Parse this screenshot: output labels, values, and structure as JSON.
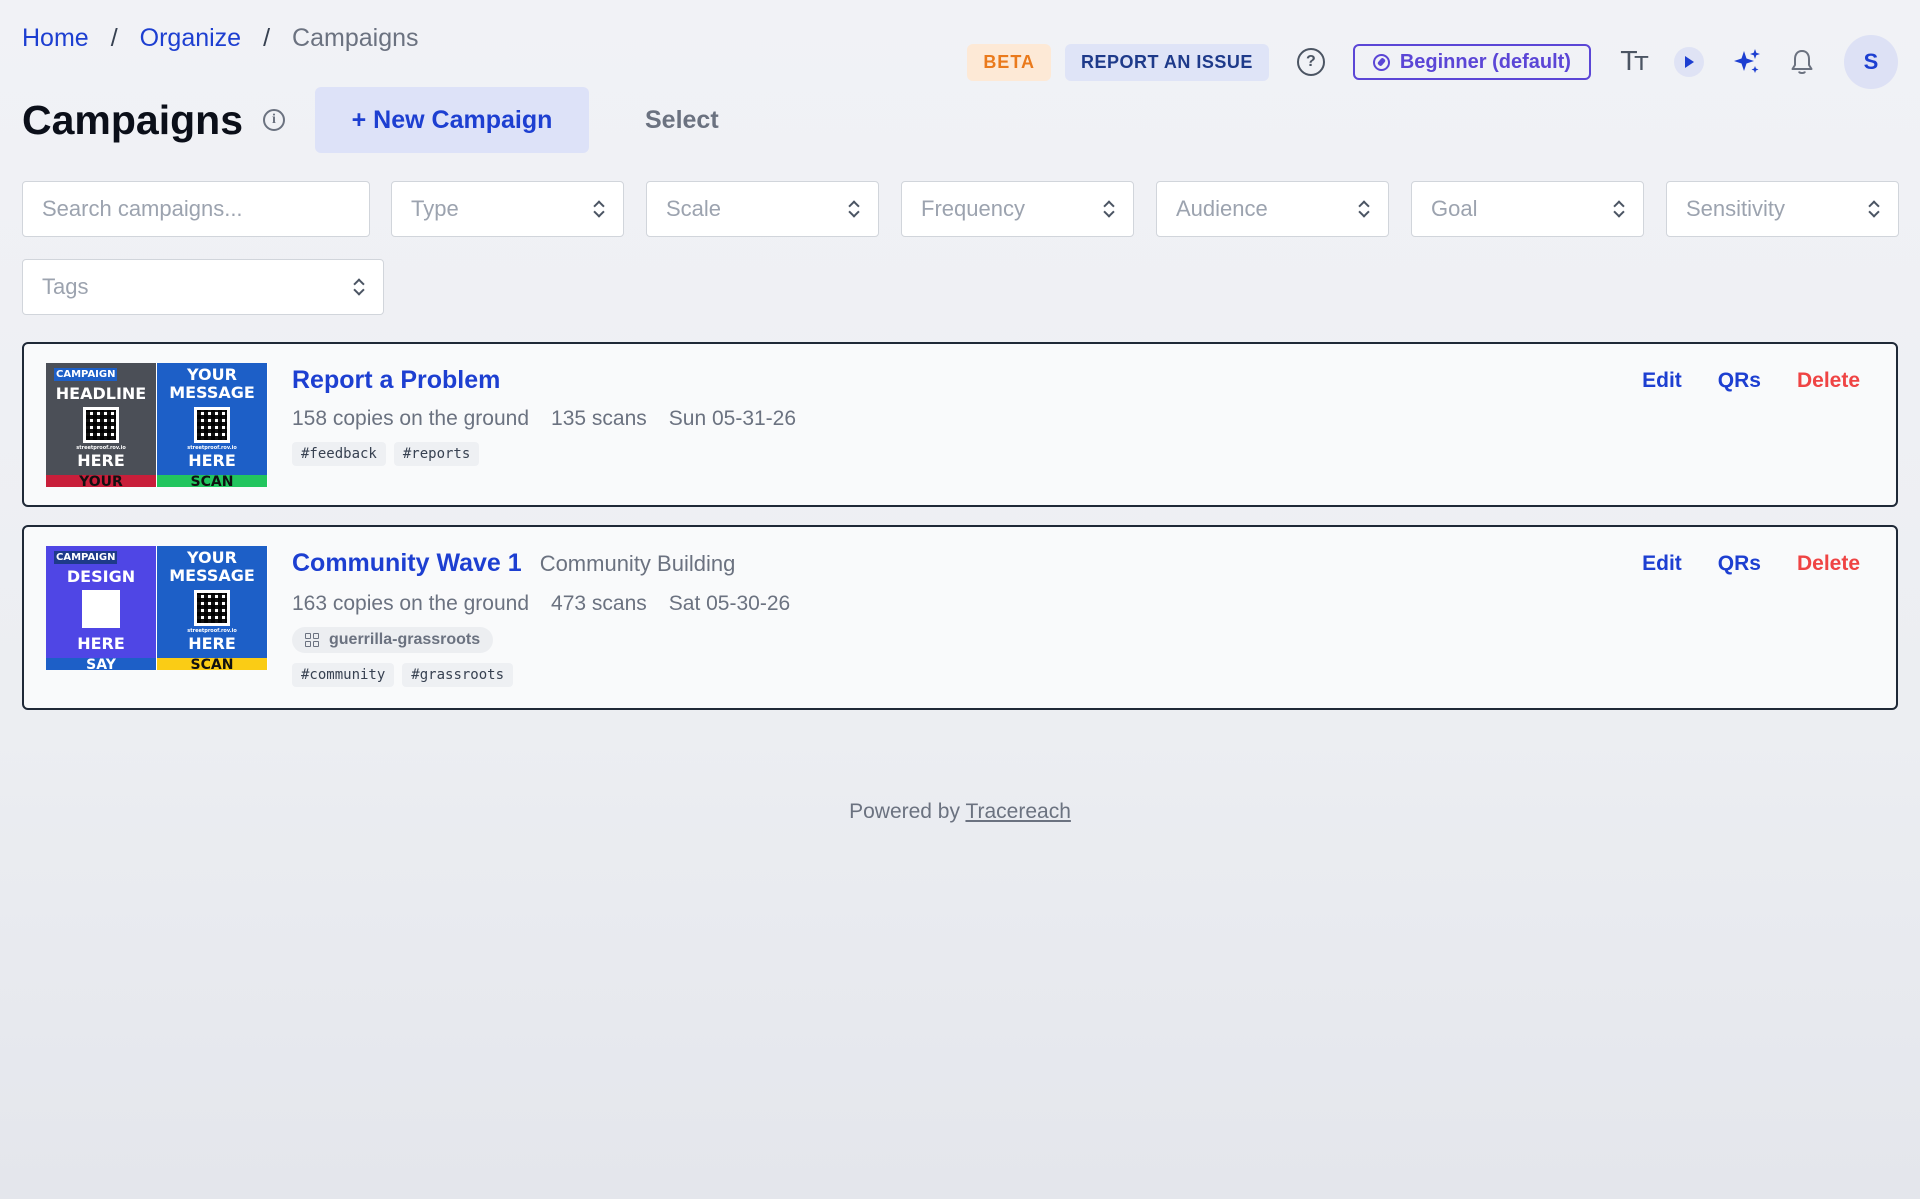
{
  "breadcrumb": {
    "home": "Home",
    "organize": "Organize",
    "current": "Campaigns",
    "sep": "/"
  },
  "topbar": {
    "beta": "BETA",
    "report": "REPORT AN ISSUE",
    "help": "?",
    "level": "Beginner (default)",
    "text_size": "Tт",
    "avatar": "S"
  },
  "header": {
    "title": "Campaigns",
    "info": "i",
    "new_campaign": "+ New Campaign",
    "select": "Select"
  },
  "filters": {
    "search_placeholder": "Search campaigns...",
    "type": "Type",
    "scale": "Scale",
    "frequency": "Frequency",
    "audience": "Audience",
    "goal": "Goal",
    "sensitivity": "Sensitivity",
    "tags": "Tags"
  },
  "campaigns": [
    {
      "title": "Report a Problem",
      "copies": "158 copies on the ground",
      "scans": "135 scans",
      "date": "Sun 05-31-26",
      "tags": [
        "#feedback",
        "#reports"
      ],
      "thumb1": {
        "tag": "CAMPAIGN",
        "line1": "HEADLINE",
        "line2": "HERE",
        "strip": "YOUR",
        "url": "streetproof.rov.io",
        "bg": "#4b4f57",
        "strip_bg": "#c81e3a"
      },
      "thumb2": {
        "line1": "YOUR MESSAGE",
        "line2": "HERE",
        "strip": "SCAN",
        "url": "streetproof.rov.io",
        "bg": "#1d5fc7",
        "strip_bg": "#22c55e"
      }
    },
    {
      "title": "Community Wave 1",
      "subtitle": "Community Building",
      "copies": "163 copies on the ground",
      "scans": "473 scans",
      "date": "Sat 05-30-26",
      "group": "guerrilla-grassroots",
      "tags": [
        "#community",
        "#grassroots"
      ],
      "thumb1": {
        "tag": "CAMPAIGN",
        "line1": "DESIGN",
        "line2": "HERE",
        "strip": "SAY",
        "bg": "#4f46e5",
        "strip_bg": "#1d5fc7"
      },
      "thumb2": {
        "line1": "YOUR MESSAGE",
        "line2": "HERE",
        "strip": "SCAN",
        "url": "streetproof.rov.io",
        "bg": "#1d5fc7",
        "strip_bg": "#facc15"
      }
    }
  ],
  "actions": {
    "edit": "Edit",
    "qrs": "QRs",
    "delete": "Delete"
  },
  "footer": {
    "prefix": "Powered by ",
    "link": "Tracereach"
  },
  "colors": {
    "accent": "#1d3fd1",
    "danger": "#ef4444",
    "beta": "#ea7a1c",
    "level": "#5b46d6"
  }
}
